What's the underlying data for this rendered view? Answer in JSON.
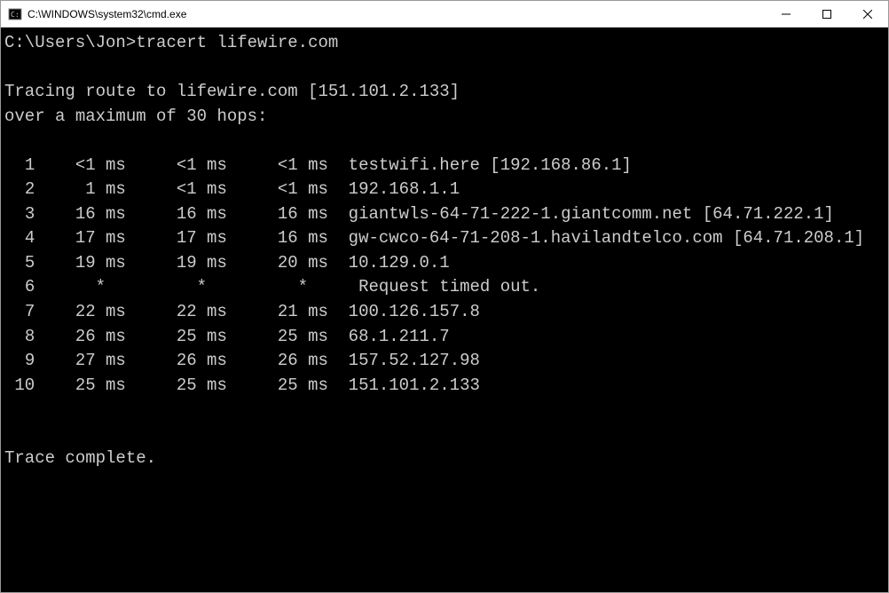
{
  "window": {
    "title": "C:\\WINDOWS\\system32\\cmd.exe"
  },
  "prompt": "C:\\Users\\Jon>",
  "command": "tracert lifewire.com",
  "header": {
    "line1": "Tracing route to lifewire.com [151.101.2.133]",
    "line2": "over a maximum of 30 hops:"
  },
  "hops": [
    {
      "n": "1",
      "t1": "<1 ms",
      "t2": "<1 ms",
      "t3": "<1 ms",
      "host": "testwifi.here [192.168.86.1]"
    },
    {
      "n": "2",
      "t1": "1 ms",
      "t2": "<1 ms",
      "t3": "<1 ms",
      "host": "192.168.1.1"
    },
    {
      "n": "3",
      "t1": "16 ms",
      "t2": "16 ms",
      "t3": "16 ms",
      "host": "giantwls-64-71-222-1.giantcomm.net [64.71.222.1]"
    },
    {
      "n": "4",
      "t1": "17 ms",
      "t2": "17 ms",
      "t3": "16 ms",
      "host": "gw-cwco-64-71-208-1.havilandtelco.com [64.71.208.1]"
    },
    {
      "n": "5",
      "t1": "19 ms",
      "t2": "19 ms",
      "t3": "20 ms",
      "host": "10.129.0.1"
    },
    {
      "n": "6",
      "t1": "*",
      "t2": "*",
      "t3": "*",
      "host": "Request timed out."
    },
    {
      "n": "7",
      "t1": "22 ms",
      "t2": "22 ms",
      "t3": "21 ms",
      "host": "100.126.157.8"
    },
    {
      "n": "8",
      "t1": "26 ms",
      "t2": "25 ms",
      "t3": "25 ms",
      "host": "68.1.211.7"
    },
    {
      "n": "9",
      "t1": "27 ms",
      "t2": "26 ms",
      "t3": "26 ms",
      "host": "157.52.127.98"
    },
    {
      "n": "10",
      "t1": "25 ms",
      "t2": "25 ms",
      "t3": "25 ms",
      "host": "151.101.2.133"
    }
  ],
  "footer": "Trace complete."
}
